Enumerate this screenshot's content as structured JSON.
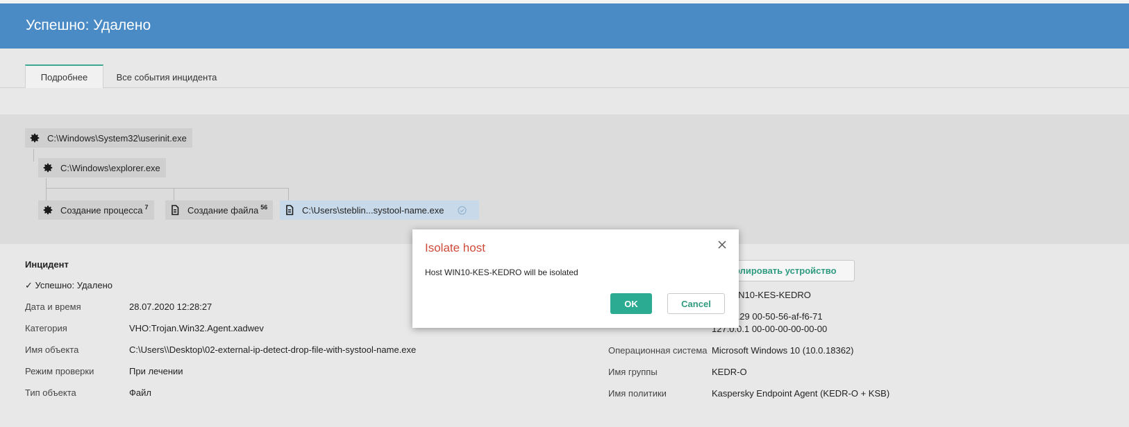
{
  "header": {
    "title": "Успешно: Удалено"
  },
  "tabs": [
    {
      "label": "Подробнее",
      "active": true
    },
    {
      "label": "Все события инцидента",
      "active": false
    }
  ],
  "tree": {
    "root": {
      "label": "C:\\Windows\\System32\\userinit.exe",
      "icon": "gear-icon"
    },
    "child": {
      "label": "C:\\Windows\\explorer.exe",
      "icon": "gear-icon"
    },
    "leaves": [
      {
        "label": "Создание процесса",
        "count": "7",
        "icon": "gear-icon"
      },
      {
        "label": "Создание файла",
        "count": "56",
        "icon": "file-icon"
      },
      {
        "label": "C:\\Users\\steblin...systool-name.exe",
        "icon": "file-icon",
        "badge_icon": "check-circle-icon"
      }
    ]
  },
  "incident": {
    "title": "Инцидент",
    "status": "✓ Успешно: Удалено",
    "fields": [
      {
        "label": "Дата и время",
        "value": "28.07.2020 12:28:27"
      },
      {
        "label": "Категория",
        "value": "VHO:Trojan.Win32.Agent.xadwev"
      },
      {
        "label": "Имя объекта",
        "value": "C:\\Users\\\\Desktop\\02-external-ip-detect-drop-file-with-systool-name.exe"
      },
      {
        "label": "Режим проверки",
        "value": "При лечении"
      },
      {
        "label": "Тип объекта",
        "value": "Файл"
      }
    ]
  },
  "device": {
    "isolate_button": "олировать устройство",
    "host": "\\ WIN10-KES-KEDRO",
    "net1": "85.129    00-50-56-af-f6-71",
    "net2": "127.0.0.1    00-00-00-00-00-00",
    "fields": [
      {
        "label": "Операционная система",
        "value": "Microsoft Windows 10 (10.0.18362)"
      },
      {
        "label": "Имя группы",
        "value": "KEDR-O"
      },
      {
        "label": "Имя политики",
        "value": "Kaspersky Endpoint Agent (KEDR-O + KSB)"
      }
    ]
  },
  "dialog": {
    "title": "Isolate host",
    "message": "Host WIN10-KES-KEDRO will be isolated",
    "ok_label": "OK",
    "cancel_label": "Cancel"
  },
  "colors": {
    "header": "#4a8bc6",
    "accent": "#2bab91",
    "dialog_title": "#d04a3a"
  }
}
